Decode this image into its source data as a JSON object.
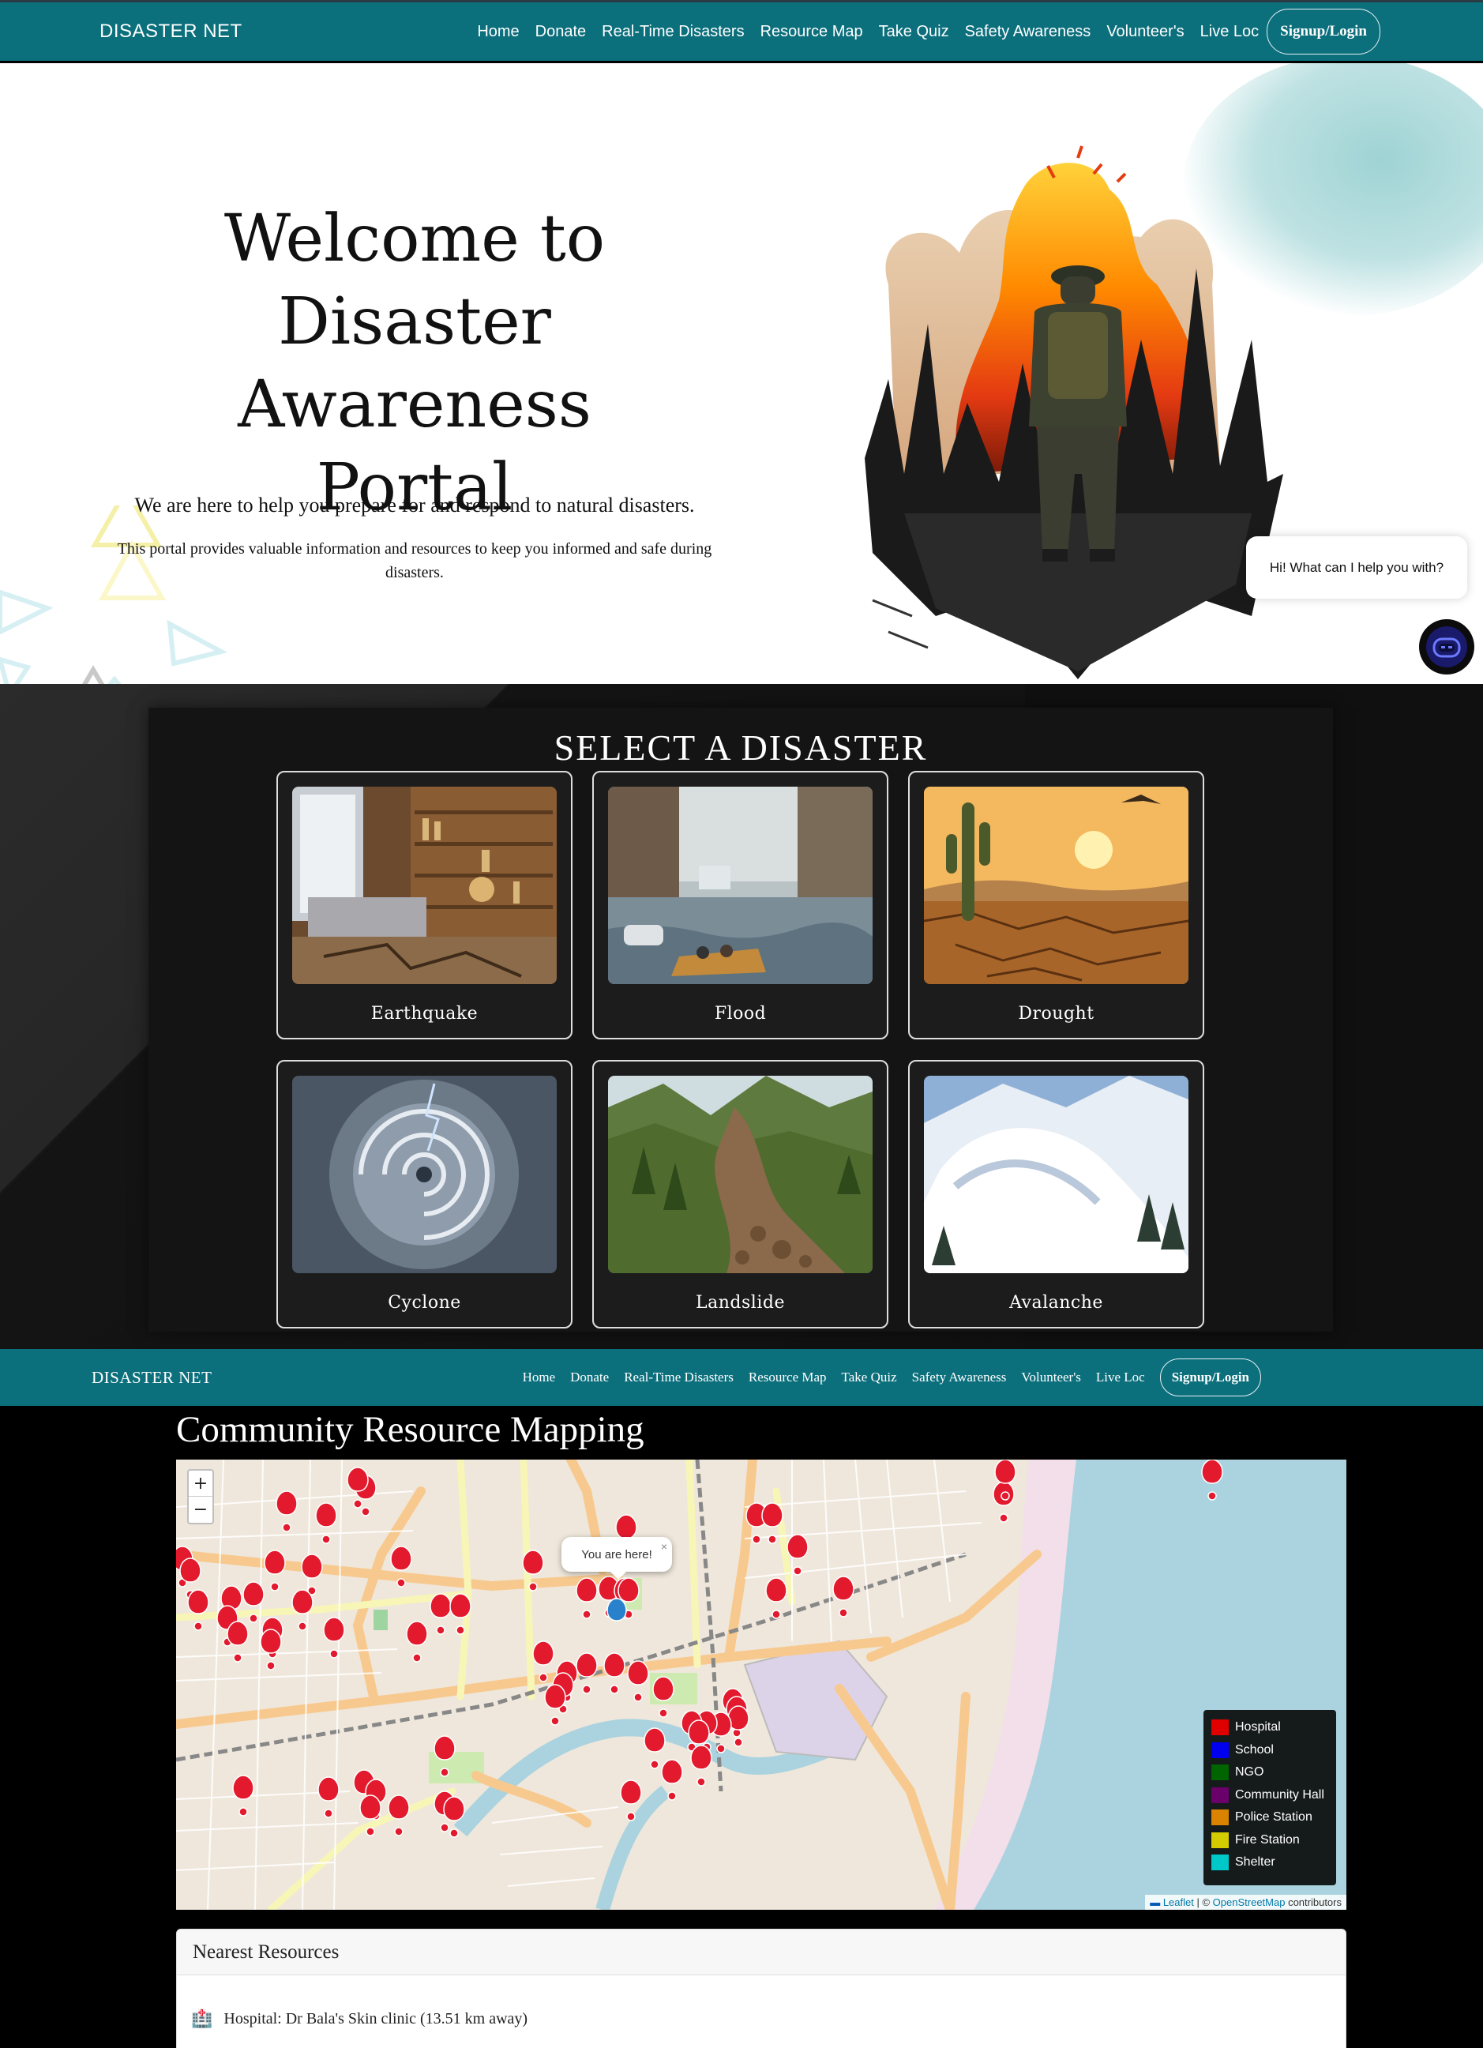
{
  "nav": {
    "brand": "DISASTER NET",
    "links": [
      "Home",
      "Donate",
      "Real-Time Disasters",
      "Resource Map",
      "Take Quiz",
      "Safety Awareness",
      "Volunteer's",
      "Live Loc"
    ],
    "login": "Signup/Login"
  },
  "hero": {
    "title_line1": "Welcome to",
    "title_line2": "Disaster Awareness",
    "title_line3": "Portal",
    "lead": "We are here to help you prepare for and respond to natural disasters.",
    "sub": "This portal provides valuable information and resources to keep you informed and safe during disasters."
  },
  "chat": {
    "greeting": "Hi! What can I help you with?"
  },
  "disasters": {
    "heading": "SELECT A DISASTER",
    "items": [
      "Earthquake",
      "Flood",
      "Drought",
      "Cyclone",
      "Landslide",
      "Avalanche"
    ]
  },
  "map": {
    "title": "Community Resource Mapping",
    "zoom_in": "+",
    "zoom_out": "−",
    "popup": "You are here!",
    "popup_close": "×",
    "legend": [
      {
        "label": "Hospital",
        "color": "#e00000"
      },
      {
        "label": "School",
        "color": "#0000ee"
      },
      {
        "label": "NGO",
        "color": "#006400"
      },
      {
        "label": "Community Hall",
        "color": "#6a006a"
      },
      {
        "label": "Police Station",
        "color": "#d98300"
      },
      {
        "label": "Fire Station",
        "color": "#d4cc00"
      },
      {
        "label": "Shelter",
        "color": "#00c8c8"
      }
    ],
    "attribution_leaflet": "Leaflet",
    "attribution_sep": " | © ",
    "attribution_osm": "OpenStreetMap",
    "attribution_tail": " contributors"
  },
  "nearest": {
    "heading": "Nearest Resources",
    "items": [
      "Hospital: Dr Bala's Skin clinic (13.51 km away)"
    ]
  }
}
